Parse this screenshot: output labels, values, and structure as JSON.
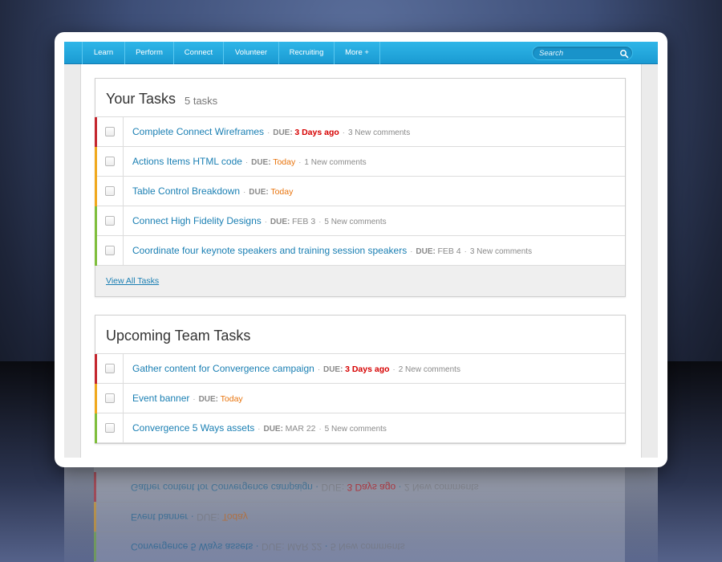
{
  "nav": {
    "items": [
      "Learn",
      "Perform",
      "Connect",
      "Volunteer",
      "Recruiting",
      "More +"
    ],
    "search_placeholder": "Search"
  },
  "your_tasks": {
    "title": "Your Tasks",
    "count": "5 tasks",
    "tasks": [
      {
        "title": "Complete Connect Wireframes",
        "due_label": "DUE:",
        "due": "3 Days ago",
        "comments": "3 New comments",
        "priority_color": "#c4262e",
        "due_color": "red"
      },
      {
        "title": "Actions Items HTML code",
        "due_label": "DUE:",
        "due": "Today",
        "comments": "1 New comments",
        "priority_color": "#f0a81c",
        "due_color": "orange"
      },
      {
        "title": "Table Control Breakdown",
        "due_label": "DUE:",
        "due": "Today",
        "comments": "",
        "priority_color": "#f0a81c",
        "due_color": "orange"
      },
      {
        "title": "Connect High Fidelity Designs",
        "due_label": "DUE:",
        "due": "FEB 3",
        "comments": "5 New comments",
        "priority_color": "#7fbe3c",
        "due_color": "gray"
      },
      {
        "title": "Coordinate four keynote speakers and training session speakers",
        "due_label": "DUE:",
        "due": "FEB 4",
        "comments": "3 New comments",
        "priority_color": "#7fbe3c",
        "due_color": "gray"
      }
    ],
    "view_all": "View All Tasks"
  },
  "team_tasks": {
    "title": "Upcoming Team Tasks",
    "tasks": [
      {
        "title": "Gather content for Convergence campaign",
        "due_label": "DUE:",
        "due": "3 Days ago",
        "comments": "2 New comments",
        "priority_color": "#c4262e",
        "due_color": "red"
      },
      {
        "title": "Event banner",
        "due_label": "DUE:",
        "due": "Today",
        "comments": "",
        "priority_color": "#f0a81c",
        "due_color": "orange"
      },
      {
        "title": "Convergence 5 Ways assets",
        "due_label": "DUE:",
        "due": "MAR 22",
        "comments": "5 New comments",
        "priority_color": "#7fbe3c",
        "due_color": "gray"
      }
    ]
  },
  "reflection": {
    "rows": [
      {
        "title": "Convergence 5 Ways assets",
        "due_label": "DUE:",
        "due": "MAR 22",
        "comments": "5 New comments",
        "priority_color": "#7fbe3c",
        "due_color": "gray"
      },
      {
        "title": "Event banner",
        "due_label": "DUE:",
        "due": "Today",
        "comments": "",
        "priority_color": "#f0a81c",
        "due_color": "orange"
      },
      {
        "title": "Gather content for Convergence campaign",
        "due_label": "DUE:",
        "due": "3 Days ago",
        "comments": "2 New comments",
        "priority_color": "#c4262e",
        "due_color": "red"
      }
    ]
  },
  "colors": {
    "nav_bg": "#1a9ad2",
    "link": "#1a7fb3",
    "due_red": "#d60000",
    "due_orange": "#e8730c",
    "priority_high": "#c4262e",
    "priority_medium": "#f0a81c",
    "priority_low": "#7fbe3c"
  },
  "icons": {
    "search": "search-icon"
  }
}
